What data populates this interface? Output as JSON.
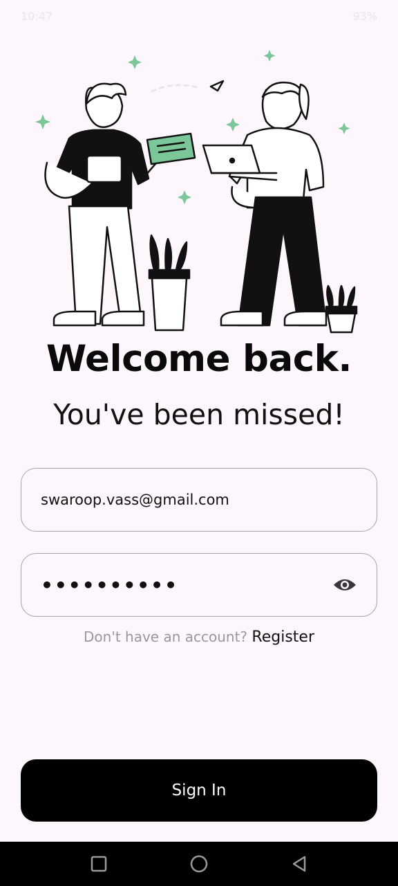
{
  "status_bar": {
    "time": "10:47",
    "battery": "93%"
  },
  "login": {
    "title": "Welcome back.",
    "subtitle": "You've been missed!",
    "email_value": "swaroop.vass@gmail.com",
    "password_mask": "••••••••••",
    "register_prompt": "Don't have an account?",
    "register_link": "Register",
    "sign_in_label": "Sign In"
  },
  "icons": {
    "password_visibility": "eye-icon",
    "nav_recents": "square-icon",
    "nav_home": "circle-icon",
    "nav_back": "triangle-back-icon"
  },
  "colors": {
    "background": "#fdf6fd",
    "accent_green": "#7cc79a",
    "button": "#000000",
    "muted_text": "#9b969b"
  }
}
